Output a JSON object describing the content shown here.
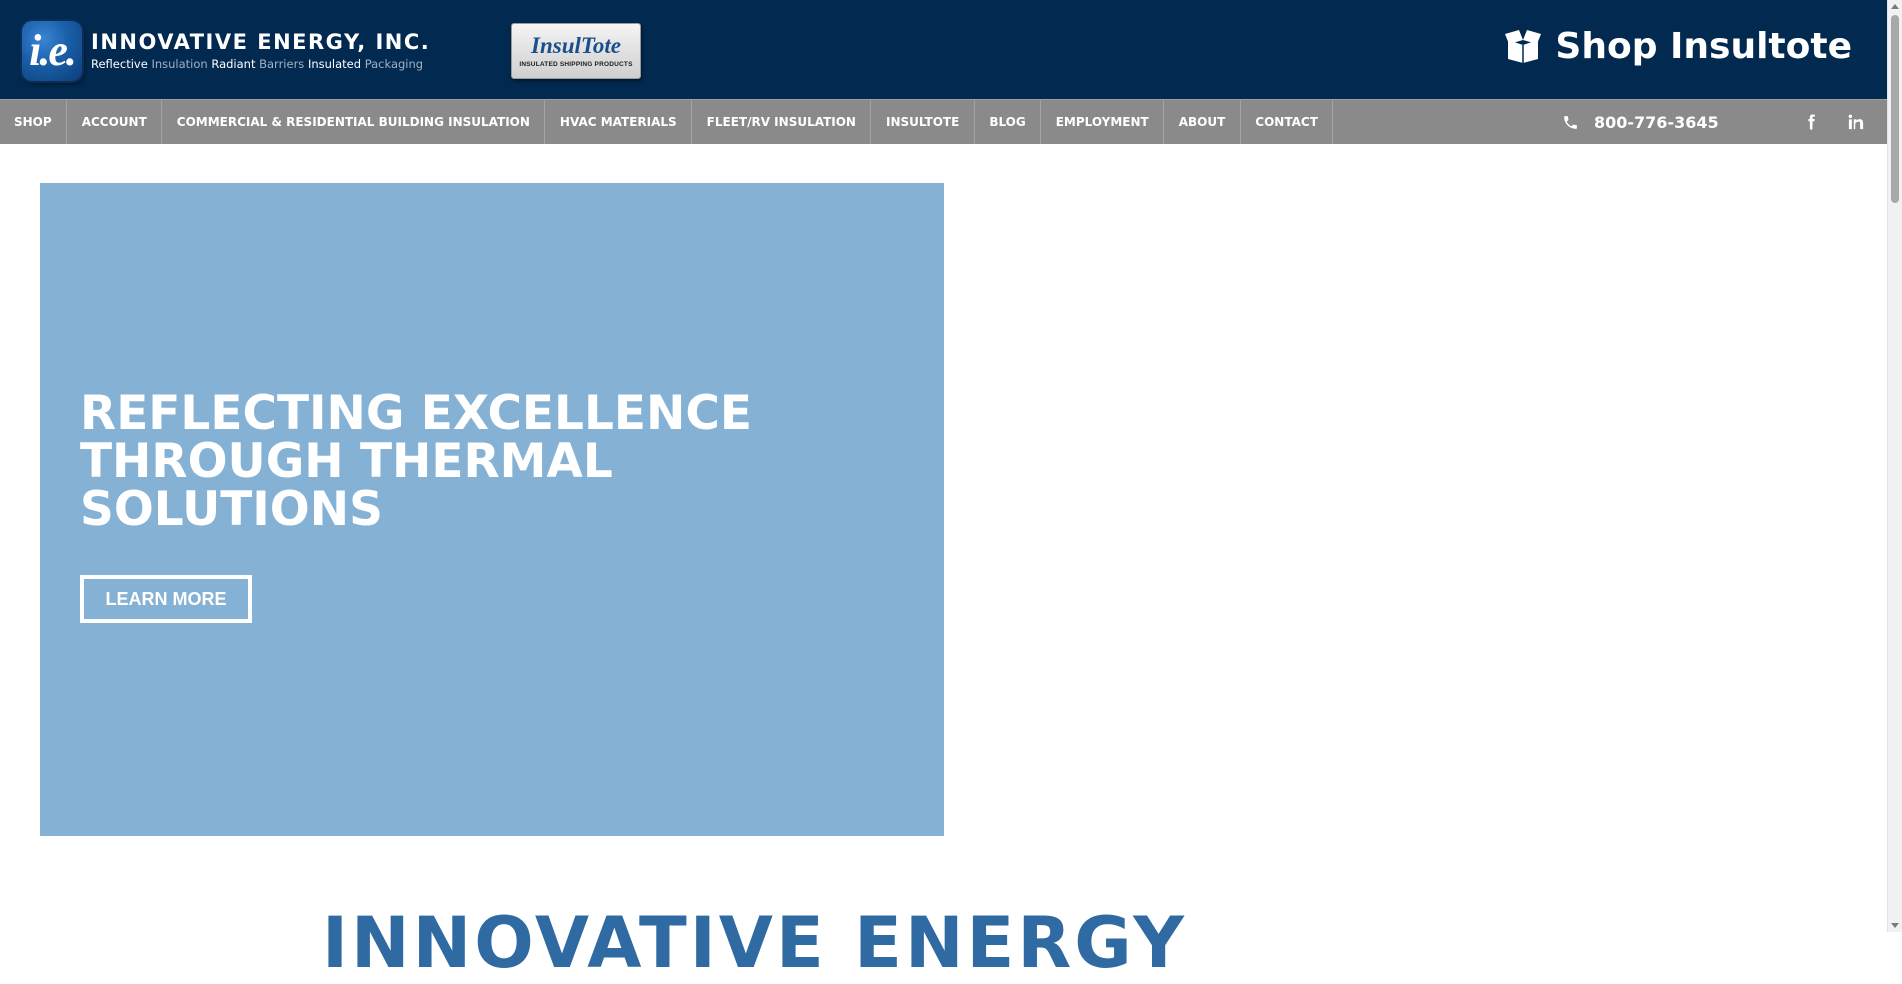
{
  "header": {
    "logo_mark": "i.e.",
    "company_name": "INNOVATIVE ENERGY, INC.",
    "tagline": [
      "Reflective",
      "Insulation",
      "Radiant",
      "Barriers",
      "Insulated",
      "Packaging"
    ],
    "insultote_logo": {
      "brand": "InsulTote",
      "subtitle": "INSULATED SHIPPING PRODUCTS"
    },
    "shop_link": {
      "label": "Shop Insultote",
      "icon": "open-box-icon"
    }
  },
  "nav": {
    "items": [
      {
        "label": "SHOP"
      },
      {
        "label": "ACCOUNT"
      },
      {
        "label": "COMMERCIAL & RESIDENTIAL BUILDING INSULATION"
      },
      {
        "label": "HVAC MATERIALS"
      },
      {
        "label": "FLEET/RV INSULATION"
      },
      {
        "label": "INSULTOTE"
      },
      {
        "label": "BLOG"
      },
      {
        "label": "EMPLOYMENT"
      },
      {
        "label": "ABOUT"
      },
      {
        "label": "CONTACT"
      }
    ],
    "phone": "800-776-3645",
    "social": [
      "facebook-icon",
      "linkedin-icon"
    ]
  },
  "hero": {
    "title": "REFLECTING EXCELLENCE THROUGH THERMAL SOLUTIONS",
    "button": "LEARN MORE"
  },
  "section": {
    "heading": "INNOVATIVE ENERGY"
  },
  "colors": {
    "header_bg": "#02294f",
    "nav_bg": "#8a8a8a",
    "hero_bg": "#85b1d4",
    "heading_blue": "#2f6aa3"
  }
}
